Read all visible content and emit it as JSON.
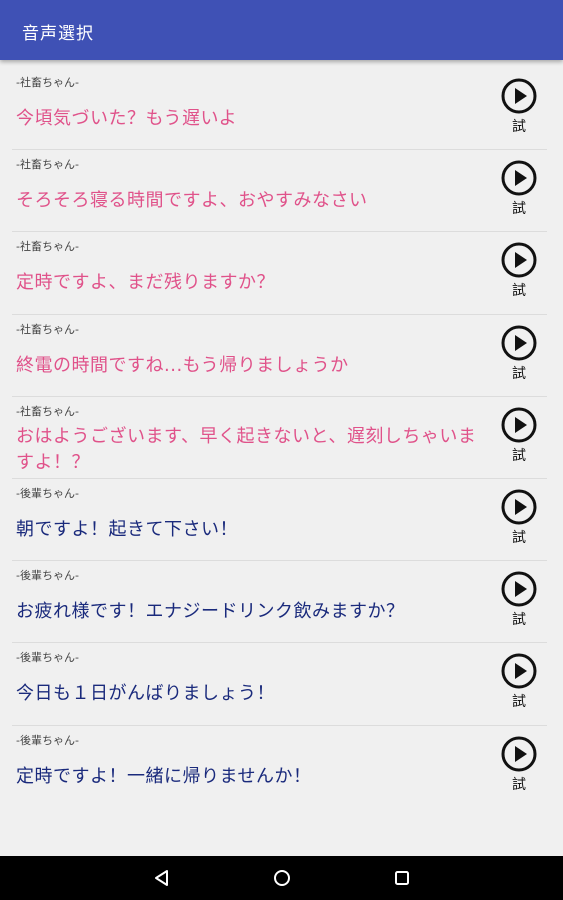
{
  "appbar": {
    "title": "音声選択"
  },
  "items": [
    {
      "speaker": "-社畜ちゃん-",
      "text": "今頃気づいた？もう遅いよ",
      "tone": "pink",
      "button": "試"
    },
    {
      "speaker": "-社畜ちゃん-",
      "text": "そろそろ寝る時間ですよ、おやすみなさい",
      "tone": "pink",
      "button": "試"
    },
    {
      "speaker": "-社畜ちゃん-",
      "text": "定時ですよ、まだ残りますか？",
      "tone": "pink",
      "button": "試"
    },
    {
      "speaker": "-社畜ちゃん-",
      "text": "終電の時間ですね...もう帰りましょうか",
      "tone": "pink",
      "button": "試"
    },
    {
      "speaker": "-社畜ちゃん-",
      "text": "おはようございます、早く起きないと、遅刻しちゃいますよ！？",
      "tone": "pink",
      "button": "試"
    },
    {
      "speaker": "-後輩ちゃん-",
      "text": "朝ですよ！起きて下さい！",
      "tone": "navy",
      "button": "試"
    },
    {
      "speaker": "-後輩ちゃん-",
      "text": "お疲れ様です！エナジードリンク飲みますか？",
      "tone": "navy",
      "button": "試"
    },
    {
      "speaker": "-後輩ちゃん-",
      "text": "今日も１日がんばりましょう！",
      "tone": "navy",
      "button": "試"
    },
    {
      "speaker": "-後輩ちゃん-",
      "text": "定時ですよ！一緒に帰りませんか！",
      "tone": "navy",
      "button": "試"
    }
  ],
  "icons": {
    "play": "play-circle-icon",
    "back": "back-icon",
    "home": "home-icon",
    "recents": "recents-icon"
  },
  "colors": {
    "appbar": "#3f51b5",
    "pink_text": "#e0528a",
    "navy_text": "#1a2a7c"
  }
}
